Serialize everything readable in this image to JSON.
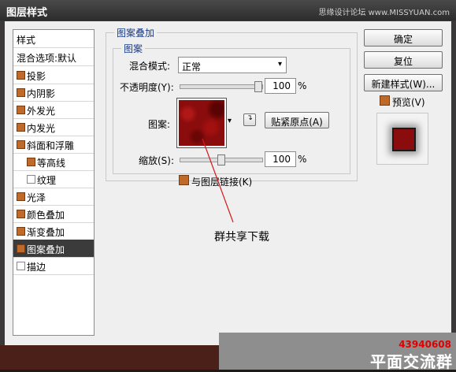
{
  "window": {
    "title": "图层样式",
    "watermark": "思缘设计论坛 www.MISSYUAN.com"
  },
  "style_list": {
    "header": "样式",
    "blend_options": "混合选项:默认",
    "items": [
      {
        "label": "投影",
        "checked": true
      },
      {
        "label": "内阴影",
        "checked": true
      },
      {
        "label": "外发光",
        "checked": true
      },
      {
        "label": "内发光",
        "checked": true
      },
      {
        "label": "斜面和浮雕",
        "checked": true
      },
      {
        "label": "等高线",
        "checked": true
      },
      {
        "label": "纹理",
        "checked": false
      },
      {
        "label": "光泽",
        "checked": true
      },
      {
        "label": "颜色叠加",
        "checked": true
      },
      {
        "label": "渐变叠加",
        "checked": true
      },
      {
        "label": "图案叠加",
        "checked": true,
        "selected": true
      },
      {
        "label": "描边",
        "checked": false
      }
    ]
  },
  "pattern_overlay": {
    "group_title": "图案叠加",
    "subgroup_title": "图案",
    "blend_mode_label": "混合模式:",
    "blend_mode_value": "正常",
    "opacity_label": "不透明度(Y):",
    "opacity_value": "100",
    "opacity_fraction": 1.0,
    "percent": "%",
    "pattern_label": "图案:",
    "snap_origin_button": "贴紧原点(A)",
    "scale_label": "缩放(S):",
    "scale_value": "100",
    "scale_fraction": 0.5,
    "link_layer_label": "与图层链接(K)",
    "link_layer_checked": true
  },
  "buttons": {
    "ok": "确定",
    "reset": "复位",
    "new_style": "新建样式(W)...",
    "preview_label": "预览(V)",
    "preview_checked": true
  },
  "annotation": {
    "text": "群共享下载"
  },
  "footer": {
    "qq": "43940608",
    "brand": "平面交流群"
  },
  "colors": {
    "accent": "#c06a2a",
    "selected_bg": "#3b3b3b",
    "legend": "#1a3c8a",
    "pattern_red": "#8a0c0c",
    "qq_red": "#e10000"
  }
}
